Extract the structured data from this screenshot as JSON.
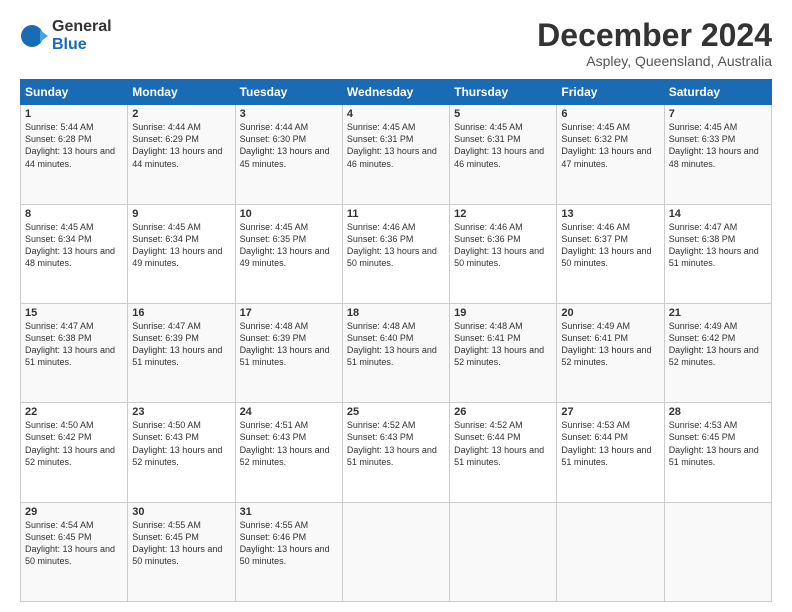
{
  "logo": {
    "general": "General",
    "blue": "Blue"
  },
  "header": {
    "title": "December 2024",
    "subtitle": "Aspley, Queensland, Australia"
  },
  "weekdays": [
    "Sunday",
    "Monday",
    "Tuesday",
    "Wednesday",
    "Thursday",
    "Friday",
    "Saturday"
  ],
  "weeks": [
    [
      {
        "day": "1",
        "sunrise": "5:44 AM",
        "sunset": "6:28 PM",
        "daylight": "13 hours and 44 minutes."
      },
      {
        "day": "2",
        "sunrise": "4:44 AM",
        "sunset": "6:29 PM",
        "daylight": "13 hours and 44 minutes."
      },
      {
        "day": "3",
        "sunrise": "4:44 AM",
        "sunset": "6:30 PM",
        "daylight": "13 hours and 45 minutes."
      },
      {
        "day": "4",
        "sunrise": "4:45 AM",
        "sunset": "6:31 PM",
        "daylight": "13 hours and 46 minutes."
      },
      {
        "day": "5",
        "sunrise": "4:45 AM",
        "sunset": "6:31 PM",
        "daylight": "13 hours and 46 minutes."
      },
      {
        "day": "6",
        "sunrise": "4:45 AM",
        "sunset": "6:32 PM",
        "daylight": "13 hours and 47 minutes."
      },
      {
        "day": "7",
        "sunrise": "4:45 AM",
        "sunset": "6:33 PM",
        "daylight": "13 hours and 48 minutes."
      }
    ],
    [
      {
        "day": "8",
        "sunrise": "4:45 AM",
        "sunset": "6:34 PM",
        "daylight": "13 hours and 48 minutes."
      },
      {
        "day": "9",
        "sunrise": "4:45 AM",
        "sunset": "6:34 PM",
        "daylight": "13 hours and 49 minutes."
      },
      {
        "day": "10",
        "sunrise": "4:45 AM",
        "sunset": "6:35 PM",
        "daylight": "13 hours and 49 minutes."
      },
      {
        "day": "11",
        "sunrise": "4:46 AM",
        "sunset": "6:36 PM",
        "daylight": "13 hours and 50 minutes."
      },
      {
        "day": "12",
        "sunrise": "4:46 AM",
        "sunset": "6:36 PM",
        "daylight": "13 hours and 50 minutes."
      },
      {
        "day": "13",
        "sunrise": "4:46 AM",
        "sunset": "6:37 PM",
        "daylight": "13 hours and 50 minutes."
      },
      {
        "day": "14",
        "sunrise": "4:47 AM",
        "sunset": "6:38 PM",
        "daylight": "13 hours and 51 minutes."
      }
    ],
    [
      {
        "day": "15",
        "sunrise": "4:47 AM",
        "sunset": "6:38 PM",
        "daylight": "13 hours and 51 minutes."
      },
      {
        "day": "16",
        "sunrise": "4:47 AM",
        "sunset": "6:39 PM",
        "daylight": "13 hours and 51 minutes."
      },
      {
        "day": "17",
        "sunrise": "4:48 AM",
        "sunset": "6:39 PM",
        "daylight": "13 hours and 51 minutes."
      },
      {
        "day": "18",
        "sunrise": "4:48 AM",
        "sunset": "6:40 PM",
        "daylight": "13 hours and 51 minutes."
      },
      {
        "day": "19",
        "sunrise": "4:48 AM",
        "sunset": "6:41 PM",
        "daylight": "13 hours and 52 minutes."
      },
      {
        "day": "20",
        "sunrise": "4:49 AM",
        "sunset": "6:41 PM",
        "daylight": "13 hours and 52 minutes."
      },
      {
        "day": "21",
        "sunrise": "4:49 AM",
        "sunset": "6:42 PM",
        "daylight": "13 hours and 52 minutes."
      }
    ],
    [
      {
        "day": "22",
        "sunrise": "4:50 AM",
        "sunset": "6:42 PM",
        "daylight": "13 hours and 52 minutes."
      },
      {
        "day": "23",
        "sunrise": "4:50 AM",
        "sunset": "6:43 PM",
        "daylight": "13 hours and 52 minutes."
      },
      {
        "day": "24",
        "sunrise": "4:51 AM",
        "sunset": "6:43 PM",
        "daylight": "13 hours and 52 minutes."
      },
      {
        "day": "25",
        "sunrise": "4:52 AM",
        "sunset": "6:43 PM",
        "daylight": "13 hours and 51 minutes."
      },
      {
        "day": "26",
        "sunrise": "4:52 AM",
        "sunset": "6:44 PM",
        "daylight": "13 hours and 51 minutes."
      },
      {
        "day": "27",
        "sunrise": "4:53 AM",
        "sunset": "6:44 PM",
        "daylight": "13 hours and 51 minutes."
      },
      {
        "day": "28",
        "sunrise": "4:53 AM",
        "sunset": "6:45 PM",
        "daylight": "13 hours and 51 minutes."
      }
    ],
    [
      {
        "day": "29",
        "sunrise": "4:54 AM",
        "sunset": "6:45 PM",
        "daylight": "13 hours and 50 minutes."
      },
      {
        "day": "30",
        "sunrise": "4:55 AM",
        "sunset": "6:45 PM",
        "daylight": "13 hours and 50 minutes."
      },
      {
        "day": "31",
        "sunrise": "4:55 AM",
        "sunset": "6:46 PM",
        "daylight": "13 hours and 50 minutes."
      },
      null,
      null,
      null,
      null
    ]
  ]
}
